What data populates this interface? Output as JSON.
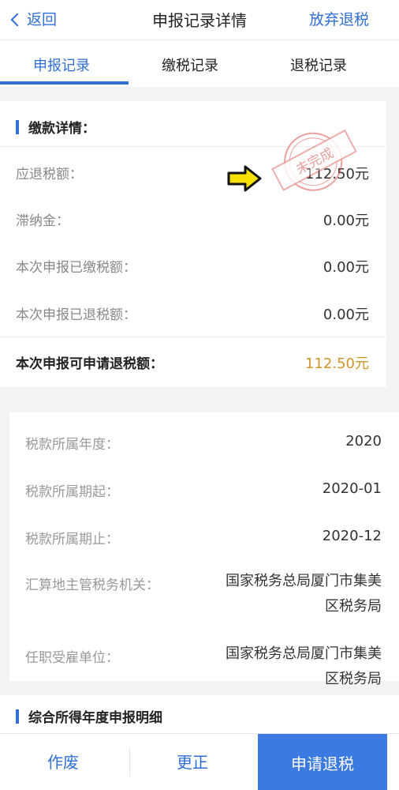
{
  "navbar": {
    "back_label": "返回",
    "title": "申报记录详情",
    "right_action": "放弃退税"
  },
  "tabs": [
    {
      "label": "申报记录",
      "active": true
    },
    {
      "label": "缴税记录",
      "active": false
    },
    {
      "label": "退税记录",
      "active": false
    }
  ],
  "payment": {
    "title": "缴款详情：",
    "rows": [
      {
        "label": "应退税额：",
        "value": "112.50元"
      },
      {
        "label": "滞纳金：",
        "value": "0.00元"
      },
      {
        "label": "本次申报已缴税额：",
        "value": "0.00元"
      },
      {
        "label": "本次申报已退税额：",
        "value": "0.00元"
      }
    ],
    "highlight": {
      "label": "本次申报可申请退税额：",
      "value": "112.50元"
    },
    "stamp_text": "未完成"
  },
  "tax_info": {
    "rows": [
      {
        "label": "税款所属年度：",
        "value": "2020"
      },
      {
        "label": "税款所属期起：",
        "value": "2020-01"
      },
      {
        "label": "税款所属期止：",
        "value": "2020-12"
      }
    ],
    "authority": {
      "label": "汇算地主管税务机关：",
      "line1": "国家税务总局厦门市集美",
      "line2": "区税务局"
    },
    "employer": {
      "label": "任职受雇单位：",
      "line1": "国家税务总局厦门市集美",
      "line2": "区税务局"
    }
  },
  "section3": {
    "title": "综合所得年度申报明细"
  },
  "bottom": {
    "void_label": "作废",
    "correct_label": "更正",
    "refund_label": "申请退税"
  },
  "colors": {
    "accent": "#2f6fd6",
    "highlight_amount": "#d3962a",
    "stamp": "#d9534f",
    "arrow": "#f5e000"
  }
}
